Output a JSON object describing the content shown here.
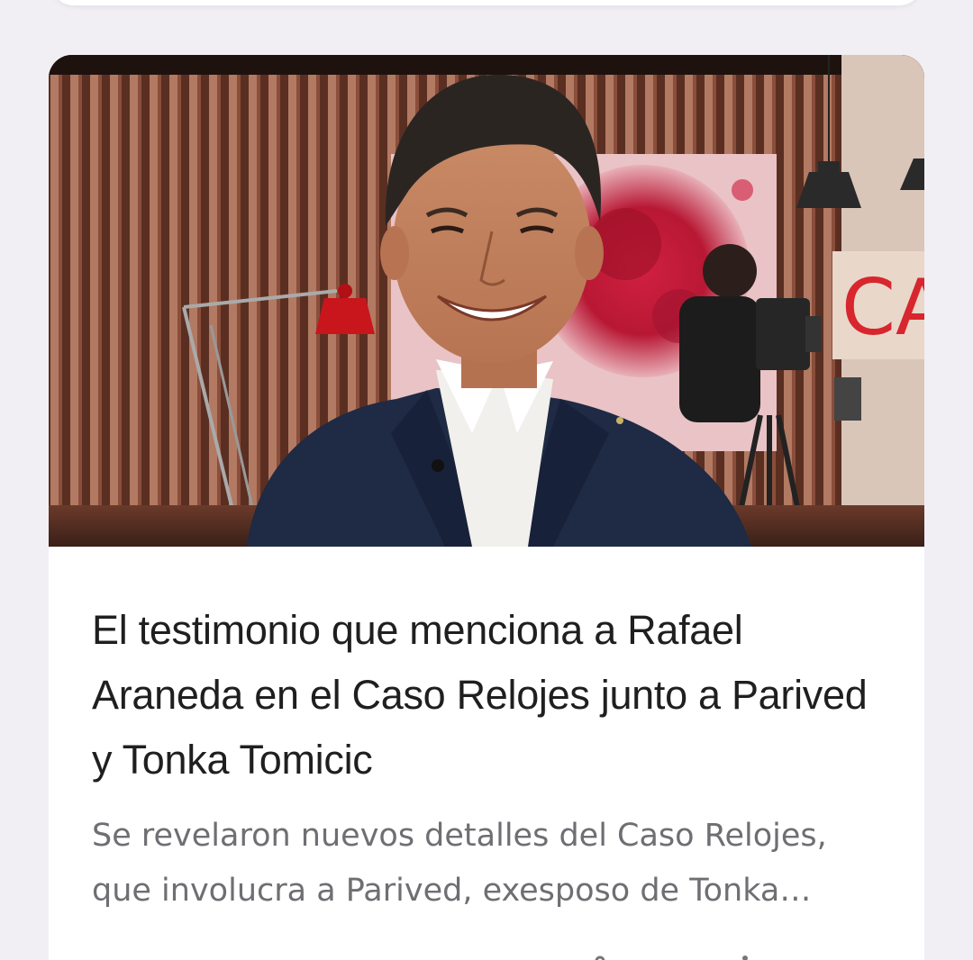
{
  "article": {
    "headline": "El testimonio que menciona a Rafael Araneda en el Caso Relojes junto a Parived y Tonka Tomicic",
    "snippet": "Se revelaron nuevos detalles del Caso Relojes, que involucra a Parived, exesposo de Tonka Tomicic, y el testimonio menciona a Rafael Araneda",
    "image_icon": "tv-studio-photo",
    "studio_sign_text": "CA"
  },
  "actions": {
    "share_icon": "share-icon",
    "more_icon": "more-vert-icon"
  },
  "colors": {
    "background": "#f1eff4",
    "card": "#ffffff",
    "headline": "#1f1f1f",
    "snippet": "#6e6e73"
  }
}
